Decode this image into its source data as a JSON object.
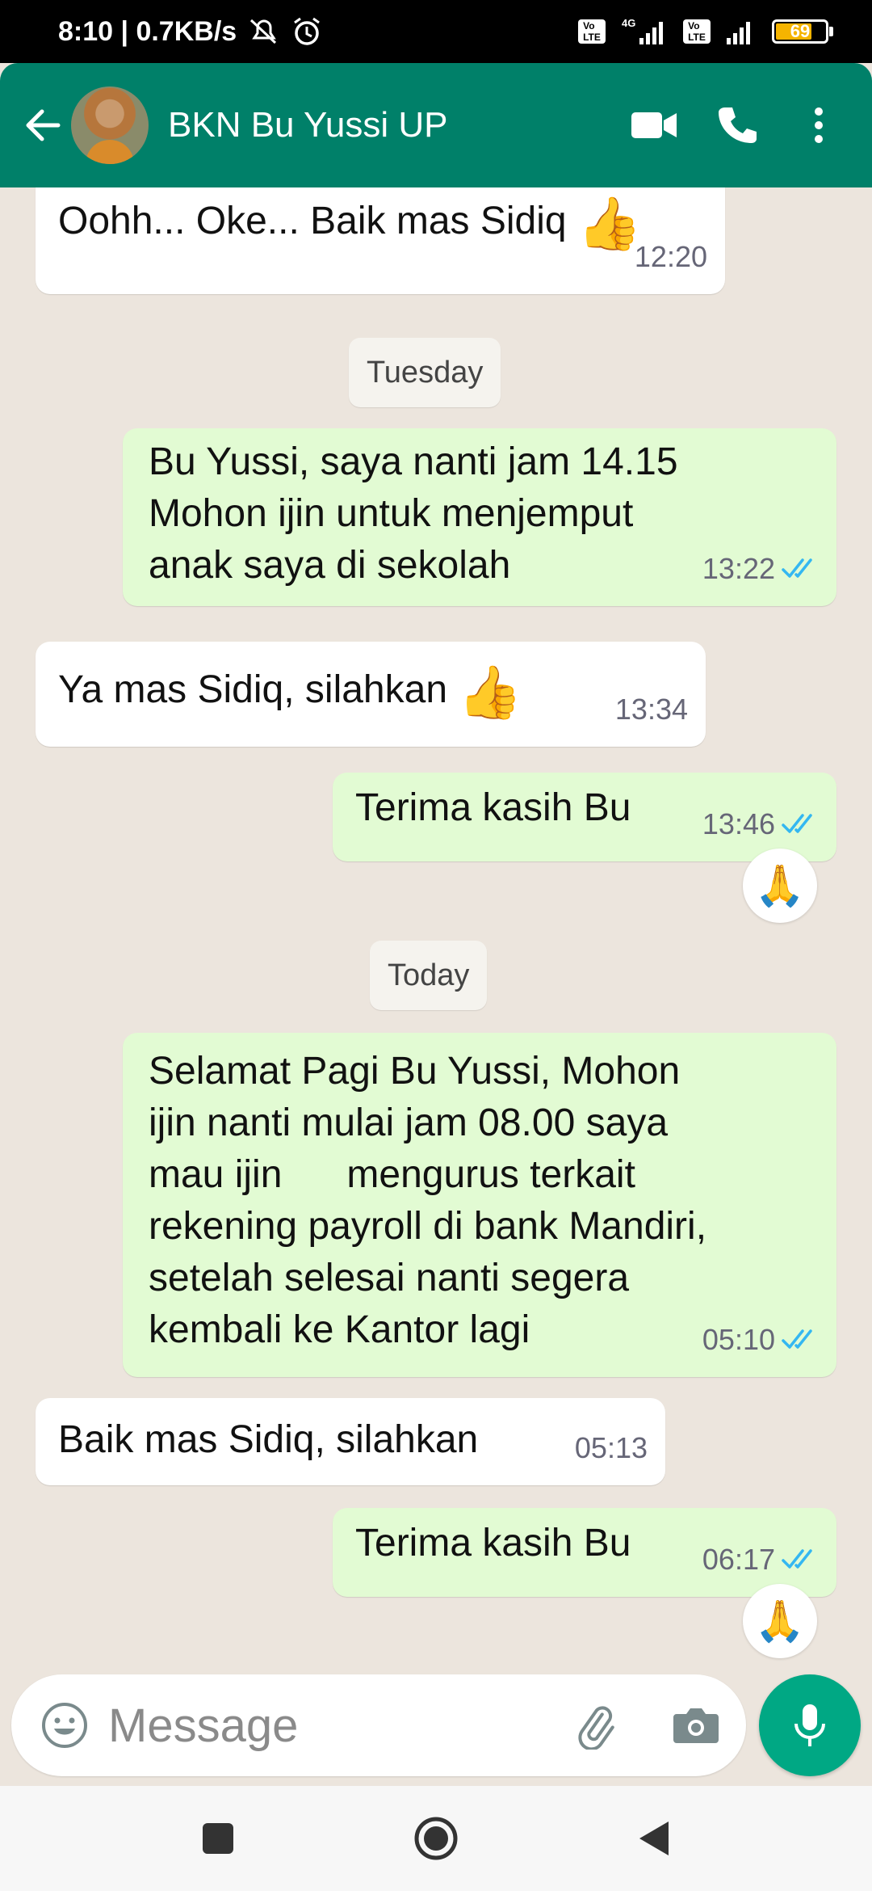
{
  "status_bar": {
    "time_speed": "8:10 | 0.7KB/s",
    "network_type": "4G",
    "lte_label": "Vo LTE",
    "battery": "69"
  },
  "header": {
    "title": "BKN Bu Yussi UP",
    "icons": [
      "back-arrow-icon",
      "avatar",
      "video-call-icon",
      "phone-call-icon",
      "more-vert-icon"
    ]
  },
  "chat": {
    "messages": [
      {
        "dir": "in",
        "text": "Oohh... Oke... Baik mas Sidiq",
        "emoji": "👍",
        "time": "12:20"
      },
      {
        "day_divider": "Tuesday"
      },
      {
        "dir": "out",
        "text": "Bu Yussi, saya nanti jam 14.15\nMohon ijin untuk menjemput\nanak saya di sekolah",
        "time": "13:22"
      },
      {
        "dir": "in",
        "text": "Ya mas Sidiq, silahkan",
        "emoji": "👍",
        "time": "13:34"
      },
      {
        "dir": "out",
        "text": "Terima kasih Bu",
        "time": "13:46",
        "reaction": "🙏"
      },
      {
        "day_divider": "Today"
      },
      {
        "dir": "out",
        "text": "Selamat Pagi Bu Yussi, Mohon\nijin nanti mulai jam 08.00 saya\nmau ijin      mengurus terkait\nrekening payroll di bank Mandiri,\nsetelah selesai nanti segera\nkembali ke Kantor lagi",
        "time": "05:10"
      },
      {
        "dir": "in",
        "text": "Baik mas Sidiq, silahkan",
        "time": "05:13"
      },
      {
        "dir": "out",
        "text": "Terima kasih Bu",
        "time": "06:17",
        "reaction": "🙏"
      }
    ],
    "day_labels": {
      "tuesday": "Tuesday",
      "today": "Today"
    }
  },
  "composer": {
    "placeholder": "Message",
    "icons": [
      "emoji-icon",
      "attach-icon",
      "camera-icon",
      "mic-icon"
    ]
  },
  "colors": {
    "header": "#008069",
    "chat_bg": "#ece5dd",
    "outgoing_bubble": "#e2fbd3",
    "incoming_bubble": "#ffffff",
    "read_ticks": "#34b7f1",
    "mic_button": "#00a884"
  }
}
